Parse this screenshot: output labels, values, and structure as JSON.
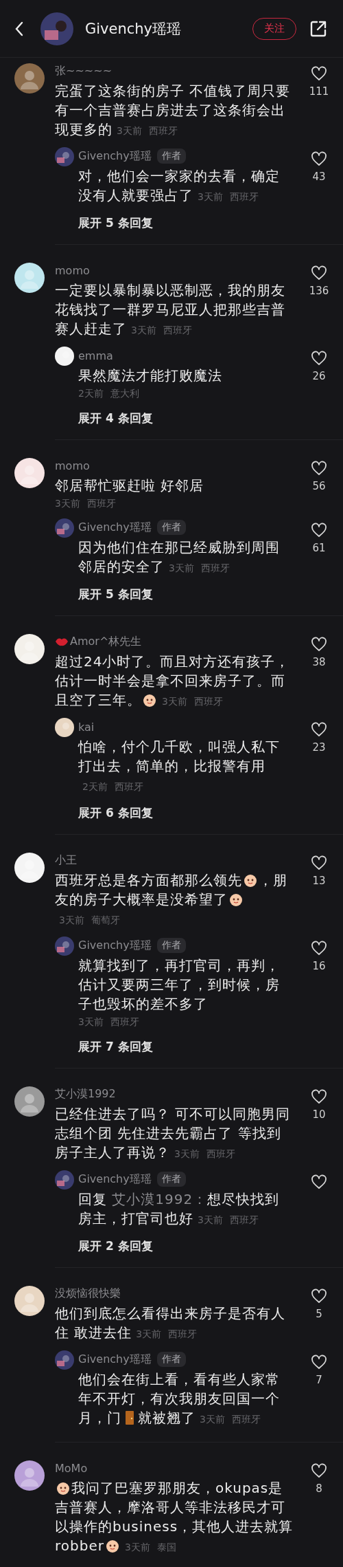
{
  "header": {
    "title": "Givenchy瑶瑶",
    "follow_label": "关注"
  },
  "comments": [
    {
      "name": "张~~~~~",
      "parts": [
        {
          "kind": "text",
          "text": "完蛋了这条街的房子 不值钱了周只要有一个吉普赛占房进去了这条街会出现更多的"
        }
      ],
      "time": "3天前",
      "location": "西班牙",
      "likes": "111",
      "replies": [
        {
          "name": "Givenchy瑶瑶",
          "author": true,
          "author_label": "作者",
          "parts": [
            {
              "kind": "text",
              "text": "对，他们会一家家的去看，确定没有人就要强占了"
            }
          ],
          "time": "3天前",
          "location": "西班牙",
          "likes": "43"
        }
      ],
      "expand": "展开 5 条回复"
    },
    {
      "name": "momo",
      "parts": [
        {
          "kind": "text",
          "text": "一定要以暴制暴以恶制恶，我的朋友花钱找了一群罗马尼亚人把那些吉普赛人赶走了"
        }
      ],
      "time": "3天前",
      "location": "西班牙",
      "likes": "136",
      "replies": [
        {
          "name": "emma",
          "author": false,
          "parts": [
            {
              "kind": "text",
              "text": "果然魔法才能打败魔法"
            }
          ],
          "time": "2天前",
          "location": "意大利",
          "likes": "26",
          "meta_below": true
        }
      ],
      "expand": "展开 4 条回复"
    },
    {
      "name": "momo",
      "parts": [
        {
          "kind": "text",
          "text": "邻居帮忙驱赶啦 好邻居"
        }
      ],
      "time": "3天前",
      "location": "西班牙",
      "likes": "56",
      "meta_below": true,
      "replies": [
        {
          "name": "Givenchy瑶瑶",
          "author": true,
          "author_label": "作者",
          "parts": [
            {
              "kind": "text",
              "text": "因为他们住在那已经威胁到周围邻居的安全了"
            }
          ],
          "time": "3天前",
          "location": "西班牙",
          "likes": "61"
        }
      ],
      "expand": "展开 5 条回复"
    },
    {
      "name": "Amor^林先生",
      "name_emoji": true,
      "parts": [
        {
          "kind": "text",
          "text": "超过24小时了。而且对方还有孩子，估计一时半会是拿不回来房子了。而且空了三年。"
        },
        {
          "kind": "face"
        }
      ],
      "time": "3天前",
      "location": "西班牙",
      "likes": "38",
      "replies": [
        {
          "name": "kai",
          "author": false,
          "parts": [
            {
              "kind": "text",
              "text": "怕啥，付个几千欧，叫强人私下打出去，简单的，比报警有用"
            }
          ],
          "time": "2天前",
          "location": "西班牙",
          "likes": "23"
        }
      ],
      "expand": "展开 6 条回复"
    },
    {
      "name": "小王",
      "parts": [
        {
          "kind": "text",
          "text": "西班牙总是各方面都那么领先"
        },
        {
          "kind": "face"
        },
        {
          "kind": "text",
          "text": "，朋友的房子大概率是没希望了"
        },
        {
          "kind": "face"
        }
      ],
      "time": "3天前",
      "location": "葡萄牙",
      "likes": "13",
      "replies": [
        {
          "name": "Givenchy瑶瑶",
          "author": true,
          "author_label": "作者",
          "parts": [
            {
              "kind": "text",
              "text": "就算找到了，再打官司，再判，估计又要两三年了，到时候，房子也毁坏的差不多了"
            }
          ],
          "time": "3天前",
          "location": "西班牙",
          "likes": "16",
          "meta_below": true
        }
      ],
      "expand": "展开 7 条回复"
    },
    {
      "name": "艾小漠1992",
      "parts": [
        {
          "kind": "text",
          "text": "已经住进去了吗？ 可不可以同胞男同志组个团 先住进去先霸占了 等找到房子主人了再说？"
        }
      ],
      "time": "3天前",
      "location": "西班牙",
      "likes": "10",
      "replies": [
        {
          "name": "Givenchy瑶瑶",
          "author": true,
          "author_label": "作者",
          "parts": [
            {
              "kind": "text",
              "text": "回复 "
            },
            {
              "kind": "mention",
              "text": "艾小漠1992："
            },
            {
              "kind": "text",
              "text": "想尽快找到房主，打官司也好"
            }
          ],
          "time": "3天前",
          "location": "西班牙"
        }
      ],
      "expand": "展开 2 条回复"
    },
    {
      "name": "没烦恼很快樂",
      "parts": [
        {
          "kind": "text",
          "text": "他们到底怎么看得出来房子是否有人住 敢进去住"
        }
      ],
      "time": "3天前",
      "location": "西班牙",
      "likes": "5",
      "replies": [
        {
          "name": "Givenchy瑶瑶",
          "author": true,
          "author_label": "作者",
          "parts": [
            {
              "kind": "text",
              "text": "他们会在街上看，看有些人家常年不开灯，有次我朋友回国一个月，门"
            },
            {
              "kind": "door"
            },
            {
              "kind": "text",
              "text": "就被翘了"
            }
          ],
          "time": "3天前",
          "location": "西班牙",
          "likes": "7"
        }
      ]
    },
    {
      "name": "MoMo",
      "parts": [
        {
          "kind": "face"
        },
        {
          "kind": "text",
          "text": "我问了巴塞罗那朋友，okupas是吉普赛人，摩洛哥人等非法移民才可以操作的business，其他人进去就算robber"
        },
        {
          "kind": "face"
        }
      ],
      "time": "3天前",
      "location": "泰国",
      "likes": "8"
    }
  ]
}
